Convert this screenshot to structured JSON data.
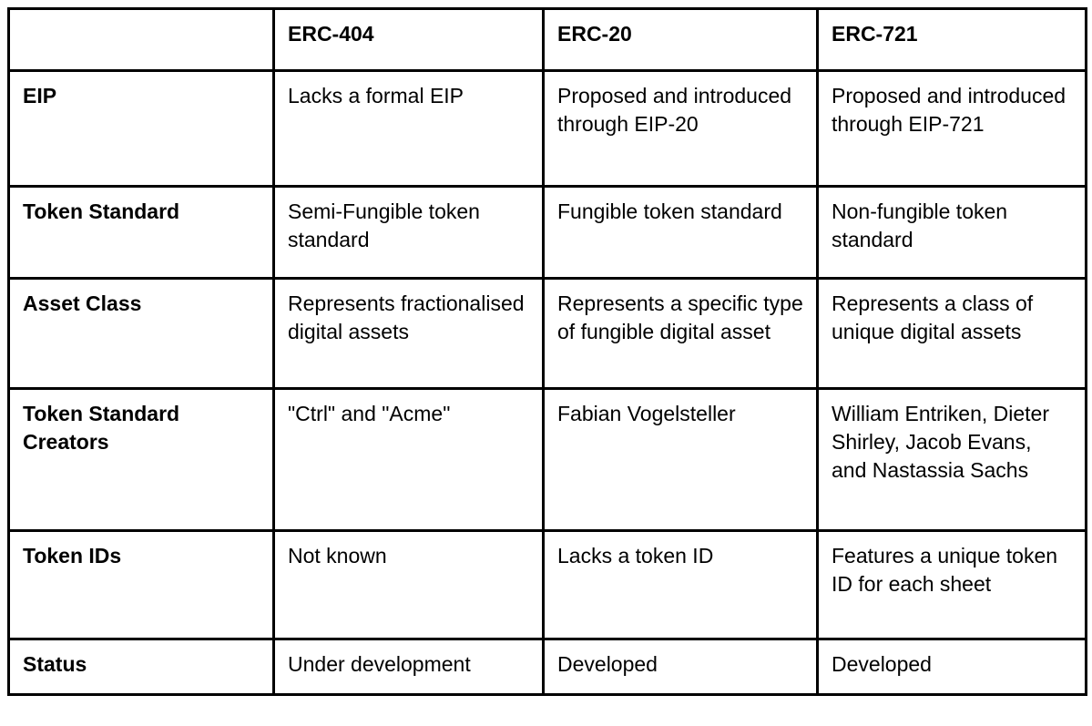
{
  "table": {
    "corner_label": "",
    "columns": [
      {
        "key": "label",
        "header": ""
      },
      {
        "key": "erc404",
        "header": "ERC-404"
      },
      {
        "key": "erc20",
        "header": "ERC-20"
      },
      {
        "key": "erc721",
        "header": "ERC-721"
      }
    ],
    "rows": [
      {
        "label": "EIP",
        "erc404": "Lacks a formal EIP",
        "erc20": "Proposed and introduced through EIP-20",
        "erc721": "Proposed and introduced through EIP-721"
      },
      {
        "label": "Token Standard",
        "erc404": "Semi-Fungible token standard",
        "erc20": "Fungible token standard",
        "erc721": "Non-fungible token standard"
      },
      {
        "label": "Asset Class",
        "erc404": "Represents fractionalised digital assets",
        "erc20": "Represents a specific type of fungible digital asset",
        "erc721": "Represents a class of unique digital assets"
      },
      {
        "label": "Token Standard Creators",
        "erc404": "\"Ctrl\" and \"Acme\"",
        "erc20": "Fabian Vogelsteller",
        "erc721": "William Entriken, Dieter Shirley, Jacob Evans, and Nastassia Sachs"
      },
      {
        "label": "Token IDs",
        "erc404": "Not known",
        "erc20": "Lacks a token ID",
        "erc721": "Features a unique token ID for each sheet"
      },
      {
        "label": "Status",
        "erc404": "Under development",
        "erc20": "Developed",
        "erc721": "Developed"
      }
    ]
  },
  "style": {
    "border_color": "#000000",
    "text_color": "#000000",
    "background": "#ffffff"
  }
}
